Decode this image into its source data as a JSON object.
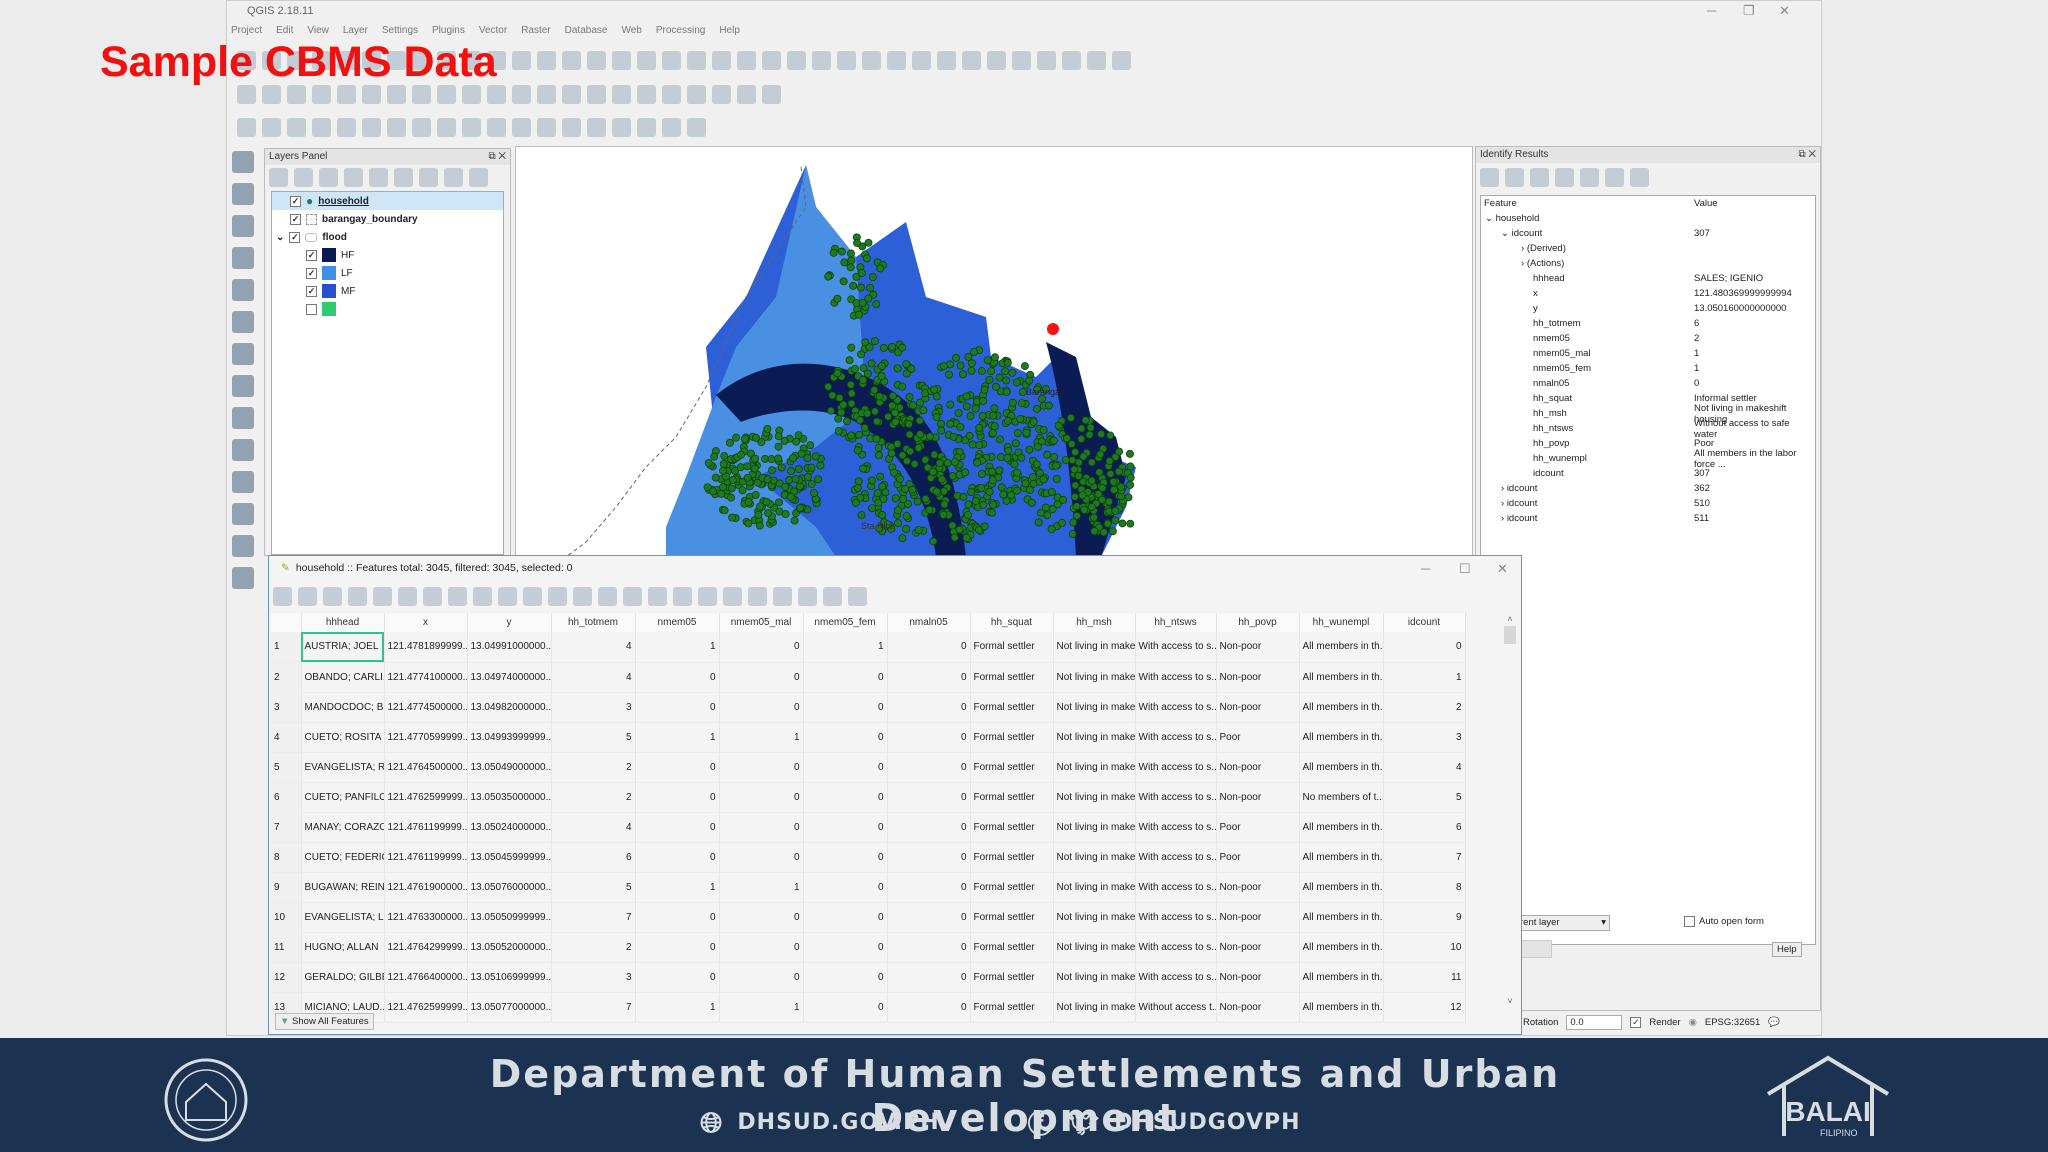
{
  "watermark": "Sample CBMS Data",
  "app": {
    "title": "QGIS 2.18.11"
  },
  "menu": [
    "Project",
    "Edit",
    "View",
    "Layer",
    "Settings",
    "Plugins",
    "Vector",
    "Raster",
    "Database",
    "Web",
    "Processing",
    "Help"
  ],
  "layers_panel": {
    "title": "Layers Panel",
    "layers": [
      {
        "name": "household",
        "checked": true,
        "selected": true
      },
      {
        "name": "barangay_boundary",
        "checked": true
      },
      {
        "name": "flood",
        "checked": true,
        "classes": [
          {
            "label": "HF",
            "color": "#0c1a55",
            "checked": true
          },
          {
            "label": "LF",
            "color": "#3f8fe6",
            "checked": true
          },
          {
            "label": "MF",
            "color": "#2650d0",
            "checked": true
          },
          {
            "label": "",
            "color": "#2ecc71",
            "checked": false
          }
        ]
      }
    ]
  },
  "map": {
    "labels": [
      "Sta Rita",
      "Barangay"
    ],
    "colors": {
      "LF": "#4a90e2",
      "MF": "#2d5fd6",
      "HF": "#0b1c55",
      "points": "#1e7a1e",
      "selected": "#ff1010"
    }
  },
  "identify": {
    "title": "Identify Results",
    "col_feature": "Feature",
    "col_value": "Value",
    "layer": "household",
    "feature": {
      "label": "idcount",
      "value": "307"
    },
    "groups": [
      "(Derived)",
      "(Actions)"
    ],
    "attrs": [
      [
        "hhhead",
        "SALES; IGENIO"
      ],
      [
        "x",
        "121.480369999999994"
      ],
      [
        "y",
        "13.050160000000000"
      ],
      [
        "hh_totmem",
        "6"
      ],
      [
        "nmem05",
        "2"
      ],
      [
        "nmem05_mal",
        "1"
      ],
      [
        "nmem05_fem",
        "1"
      ],
      [
        "nmaln05",
        "0"
      ],
      [
        "hh_squat",
        "Informal settler"
      ],
      [
        "hh_msh",
        "Not living in makeshift housing"
      ],
      [
        "hh_ntsws",
        "Without access to safe water"
      ],
      [
        "hh_povp",
        "Poor"
      ],
      [
        "hh_wunempl",
        "All members in the labor force ..."
      ],
      [
        "idcount",
        "307"
      ]
    ],
    "others": [
      [
        "idcount",
        "362"
      ],
      [
        "idcount",
        "510"
      ],
      [
        "idcount",
        "511"
      ]
    ],
    "mode": "rent layer",
    "auto_open": "Auto open form",
    "help": "Help"
  },
  "statusbar": {
    "rotation_label": "Rotation",
    "rotation": "0.0",
    "render": "Render",
    "crs": "EPSG:32651"
  },
  "attribute_table": {
    "title": "household :: Features total: 3045, filtered: 3045, selected: 0",
    "columns": [
      "hhhead",
      "x",
      "y",
      "hh_totmem",
      "nmem05",
      "nmem05_mal",
      "nmem05_fem",
      "nmaln05",
      "hh_squat",
      "hh_msh",
      "hh_ntsws",
      "hh_povp",
      "hh_wunempl",
      "idcount"
    ],
    "rows": [
      [
        "AUSTRIA; JOEL",
        "121.4781899999...",
        "13.04991000000...",
        "4",
        "1",
        "0",
        "1",
        "0",
        "Formal settler",
        "Not living in make...",
        "With access to s...",
        "Non-poor",
        "All members in th...",
        "0"
      ],
      [
        "OBANDO; CARLI...",
        "121.4774100000...",
        "13.04974000000...",
        "4",
        "0",
        "0",
        "0",
        "0",
        "Formal settler",
        "Not living in make...",
        "With access to s...",
        "Non-poor",
        "All members in th...",
        "1"
      ],
      [
        "MANDOCDOC; B...",
        "121.4774500000...",
        "13.04982000000...",
        "3",
        "0",
        "0",
        "0",
        "0",
        "Formal settler",
        "Not living in make...",
        "With access to s...",
        "Non-poor",
        "All members in th...",
        "2"
      ],
      [
        "CUETO; ROSITA",
        "121.4770599999...",
        "13.04993999999...",
        "5",
        "1",
        "1",
        "0",
        "0",
        "Formal settler",
        "Not living in make...",
        "With access to s...",
        "Poor",
        "All members in th...",
        "3"
      ],
      [
        "EVANGELISTA; R...",
        "121.4764500000...",
        "13.05049000000...",
        "2",
        "0",
        "0",
        "0",
        "0",
        "Formal settler",
        "Not living in make...",
        "With access to s...",
        "Non-poor",
        "All members in th...",
        "4"
      ],
      [
        "CUETO; PANFILO",
        "121.4762599999...",
        "13.05035000000...",
        "2",
        "0",
        "0",
        "0",
        "0",
        "Formal settler",
        "Not living in make...",
        "With access to s...",
        "Non-poor",
        "No members of t...",
        "5"
      ],
      [
        "MANAY; CORAZON",
        "121.4761199999...",
        "13.05024000000...",
        "4",
        "0",
        "0",
        "0",
        "0",
        "Formal settler",
        "Not living in make...",
        "With access to s...",
        "Poor",
        "All members in th...",
        "6"
      ],
      [
        "CUETO; FEDERICO",
        "121.4761199999...",
        "13.05045999999...",
        "6",
        "0",
        "0",
        "0",
        "0",
        "Formal settler",
        "Not living in make...",
        "With access to s...",
        "Poor",
        "All members in th...",
        "7"
      ],
      [
        "BUGAWAN; REIN...",
        "121.4761900000...",
        "13.05076000000...",
        "5",
        "1",
        "1",
        "0",
        "0",
        "Formal settler",
        "Not living in make...",
        "With access to s...",
        "Non-poor",
        "All members in th...",
        "8"
      ],
      [
        "EVANGELISTA; L...",
        "121.4763300000...",
        "13.05050999999...",
        "7",
        "0",
        "0",
        "0",
        "0",
        "Formal settler",
        "Not living in make...",
        "With access to s...",
        "Non-poor",
        "All members in th...",
        "9"
      ],
      [
        "HUGNO; ALLAN",
        "121.4764299999...",
        "13.05052000000...",
        "2",
        "0",
        "0",
        "0",
        "0",
        "Formal settler",
        "Not living in make...",
        "With access to s...",
        "Non-poor",
        "All members in th...",
        "10"
      ],
      [
        "GERALDO; GILBE...",
        "121.4766400000...",
        "13.05106999999...",
        "3",
        "0",
        "0",
        "0",
        "0",
        "Formal settler",
        "Not living in make...",
        "With access to s...",
        "Non-poor",
        "All members in th...",
        "11"
      ],
      [
        "MICIANO; LAUD...",
        "121.4762599999...",
        "13.05077000000...",
        "7",
        "1",
        "1",
        "0",
        "0",
        "Formal settler",
        "Not living in make...",
        "Without access t...",
        "Non-poor",
        "All members in th...",
        "12"
      ]
    ],
    "show_all": "Show All Features"
  },
  "banner": {
    "title": "Department of Human Settlements and Urban Development",
    "website": "DHSUD.GOV.PH",
    "social": "DHSUDGOVPH",
    "logo_right": "BALAI",
    "logo_right_sub": "FILIPINO"
  }
}
